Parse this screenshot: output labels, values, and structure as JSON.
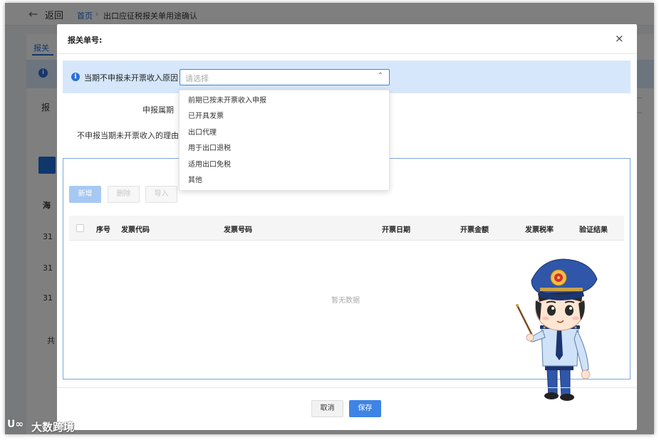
{
  "background": {
    "back_icon": "arrow-left-icon",
    "back_label": "返回",
    "breadcrumb": {
      "home": "首页",
      "separator": "›",
      "current": "出口应征税报关单用途确认"
    },
    "tab_label": "报关",
    "info_icon": "i",
    "label_partial": "报",
    "column_partial": "海",
    "row_prefixes": [
      "31",
      "31",
      "31"
    ],
    "footer_partial": "共"
  },
  "dialog": {
    "title": "报关单号:",
    "close_icon": "×",
    "info": {
      "icon": "i",
      "label": "当期不申报未开票收入原因",
      "select_placeholder": "请选择",
      "chevron_icon": "⌃"
    },
    "period_label": "申报属期",
    "reason_label": "不申报当期未开票收入的理由",
    "actions": {
      "add": "新增",
      "delete": "删除",
      "import": "导入"
    },
    "table": {
      "columns": [
        "序号",
        "发票代码",
        "发票号码",
        "开票日期",
        "开票金额",
        "发票税率",
        "验证结果"
      ],
      "empty_text": "暂无数据"
    },
    "footer": {
      "cancel": "取消",
      "save": "保存"
    }
  },
  "dropdown": {
    "options": [
      "前期已按未开票收入申报",
      "已开具发票",
      "出口代理",
      "用于出口退税",
      "适用出口免税",
      "其他"
    ]
  },
  "watermark": {
    "logo": "ᑌ∞",
    "text": "大数跨境"
  },
  "colors": {
    "primary": "#3d84e6",
    "info_bg": "#d6e7fb",
    "mascot_uniform": "#2f56a8"
  }
}
